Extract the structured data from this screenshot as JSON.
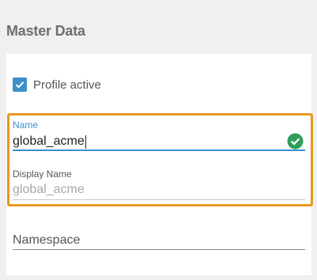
{
  "section": {
    "title": "Master Data"
  },
  "profile_active": {
    "label": "Profile active",
    "checked": true
  },
  "name_field": {
    "label": "Name",
    "value": "global_acme",
    "valid": true
  },
  "display_name_field": {
    "label": "Display Name",
    "placeholder": "global_acme"
  },
  "namespace_field": {
    "placeholder": "Namespace"
  },
  "colors": {
    "accent": "#3d8fc8",
    "highlight": "#e8971f",
    "success": "#2e9e58"
  },
  "icons": {
    "checkbox": "checkmark-icon",
    "valid": "check-circle-icon"
  }
}
